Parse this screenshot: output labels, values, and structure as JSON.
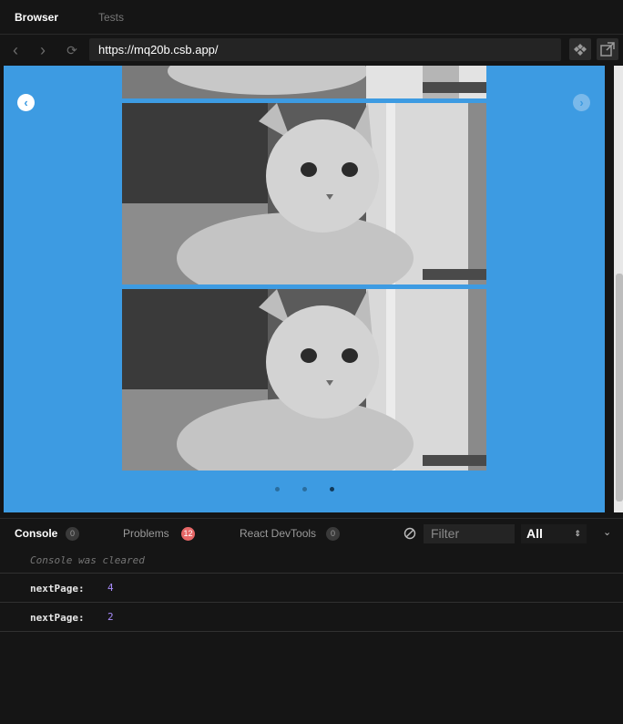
{
  "tabs": {
    "browser": "Browser",
    "tests": "Tests"
  },
  "nav": {
    "url": "https://mq20b.csb.app/"
  },
  "carousel": {
    "prev_arrow": "‹",
    "next_arrow": "›",
    "active_page_index": 3
  },
  "devtools": {
    "tabs": [
      {
        "label": "Console",
        "count": "0"
      },
      {
        "label": "Problems",
        "count": "12"
      },
      {
        "label": "React DevTools",
        "count": "0"
      }
    ],
    "filter_placeholder": "Filter",
    "level": "All",
    "console_cleared": "Console was cleared",
    "logs": [
      {
        "key": "nextPage:",
        "value": "4"
      },
      {
        "key": "nextPage:",
        "value": "2"
      }
    ]
  },
  "colors": {
    "accent": "#3d9be2",
    "badge_error": "#e66767",
    "log_value": "#a78bfa"
  }
}
